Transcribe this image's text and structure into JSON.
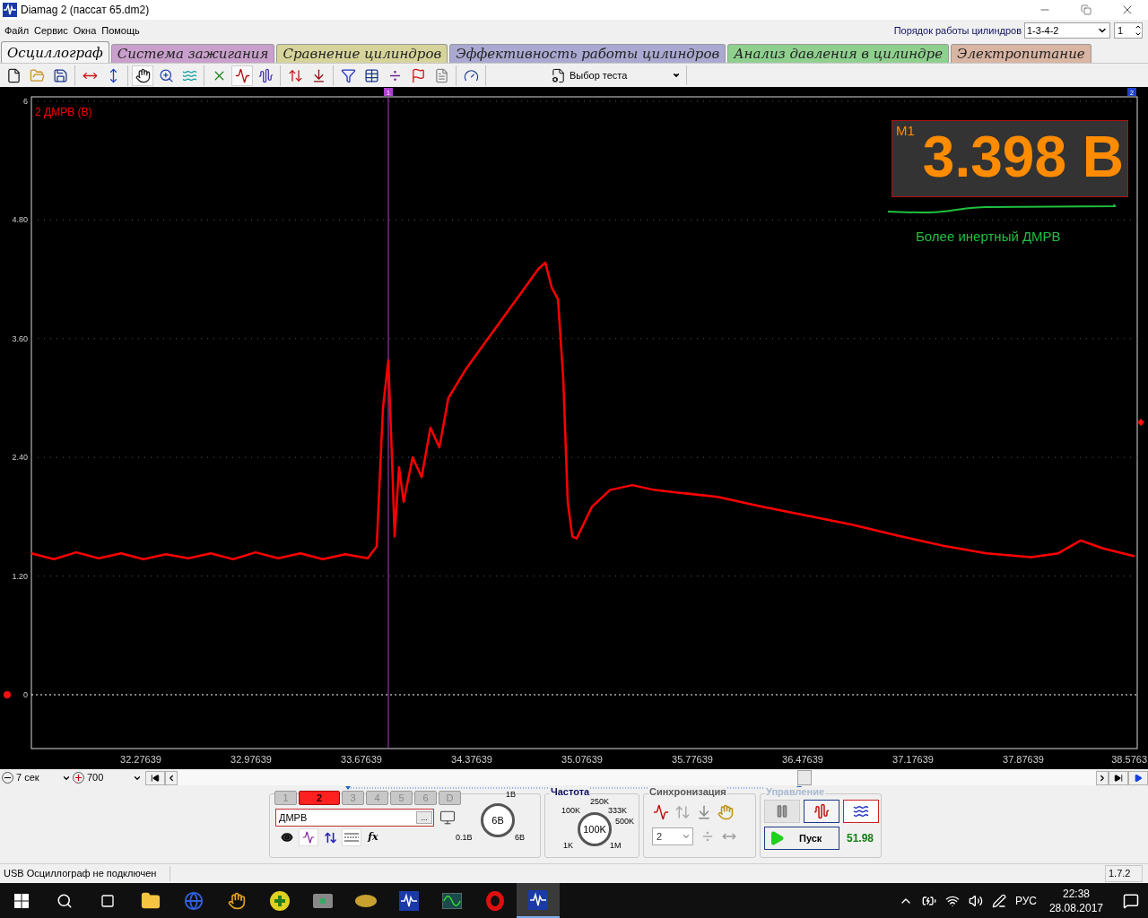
{
  "window": {
    "title": "Diamag 2 (пассат 65.dm2)"
  },
  "menu": [
    "Файл",
    "Сервис",
    "Окна",
    "Помощь"
  ],
  "cylinder_order": {
    "label": "Порядок работы цилиндров",
    "value": "1-3-4-2",
    "cylinder": "1"
  },
  "tabs": [
    {
      "label": "Осциллограф",
      "selected": true,
      "color": "#f4f4f4"
    },
    {
      "label": "Система зажигания",
      "selected": false,
      "color": "#c9a0cc"
    },
    {
      "label": "Сравнение цилиндров",
      "selected": false,
      "color": "#d6d49a"
    },
    {
      "label": "Эффективность работы цилиндров",
      "selected": false,
      "color": "#a9a9d2"
    },
    {
      "label": "Анализ давления в цилиндре",
      "selected": false,
      "color": "#8fd08f"
    },
    {
      "label": "Электропитание",
      "selected": false,
      "color": "#d9b5a3"
    }
  ],
  "toolbar": {
    "groups": [
      [
        {
          "kind": "new",
          "selected": false
        },
        {
          "kind": "open",
          "selected": false
        },
        {
          "kind": "save",
          "selected": false
        }
      ],
      [
        {
          "kind": "span-h",
          "selected": false
        },
        {
          "kind": "span-v",
          "selected": false
        }
      ],
      [
        {
          "kind": "hand",
          "selected": true
        },
        {
          "kind": "zoom",
          "selected": false
        },
        {
          "kind": "fit",
          "selected": false
        }
      ],
      [
        {
          "kind": "cross",
          "selected": false
        },
        {
          "kind": "stack",
          "selected": true
        },
        {
          "kind": "overlay",
          "selected": false
        }
      ],
      [
        {
          "kind": "auto",
          "selected": false
        },
        {
          "kind": "zero",
          "selected": false
        }
      ],
      [
        {
          "kind": "filter",
          "selected": false
        },
        {
          "kind": "grid",
          "selected": false
        },
        {
          "kind": "divide",
          "selected": false
        },
        {
          "kind": "flag",
          "selected": false
        },
        {
          "kind": "checklist",
          "selected": false
        }
      ],
      [
        {
          "kind": "gauge",
          "selected": false
        }
      ]
    ],
    "test_select": "Выбор теста"
  },
  "scope": {
    "chart_data": {
      "type": "line",
      "xlim": [
        31.582,
        38.599
      ],
      "ylim": [
        -0.544,
        6.045
      ],
      "x": [
        31.582,
        31.724,
        31.867,
        32.009,
        32.151,
        32.293,
        32.436,
        32.578,
        32.72,
        32.862,
        33.005,
        33.147,
        33.289,
        33.431,
        33.574,
        33.716,
        33.773,
        33.813,
        33.847,
        33.87,
        33.887,
        33.915,
        33.944,
        34.001,
        34.058,
        34.114,
        34.171,
        34.228,
        34.342,
        34.456,
        34.57,
        34.684,
        34.797,
        34.843,
        34.883,
        34.923,
        34.957,
        34.985,
        35.014,
        35.042,
        35.139,
        35.253,
        35.395,
        35.537,
        35.708,
        35.936,
        36.22,
        36.505,
        36.789,
        37.074,
        37.358,
        37.643,
        37.927,
        38.098,
        38.24,
        38.383,
        38.582
      ],
      "series": [
        {
          "name": "2 ДМРВ (В)",
          "color": "#ff0000",
          "values": [
            1.43,
            1.37,
            1.44,
            1.38,
            1.43,
            1.37,
            1.42,
            1.38,
            1.43,
            1.37,
            1.44,
            1.38,
            1.43,
            1.37,
            1.42,
            1.38,
            1.5,
            2.9,
            3.38,
            2.4,
            1.6,
            2.3,
            1.95,
            2.4,
            2.2,
            2.7,
            2.5,
            3.0,
            3.3,
            3.55,
            3.8,
            4.05,
            4.3,
            4.37,
            4.12,
            4.0,
            3.2,
            1.95,
            1.6,
            1.58,
            1.9,
            2.07,
            2.12,
            2.07,
            2.04,
            2.0,
            1.9,
            1.81,
            1.72,
            1.61,
            1.51,
            1.43,
            1.39,
            1.43,
            1.56,
            1.48,
            1.4
          ]
        }
      ],
      "xticks": [
        {
          "value": 32.27639,
          "label": "32.27639"
        },
        {
          "value": 32.97639,
          "label": "32.97639"
        },
        {
          "value": 33.67639,
          "label": "33.67639"
        },
        {
          "value": 34.37639,
          "label": "34.37639"
        },
        {
          "value": 35.07639,
          "label": "35.07639"
        },
        {
          "value": 35.77639,
          "label": "35.77639"
        },
        {
          "value": 36.47639,
          "label": "36.47639"
        },
        {
          "value": 37.17639,
          "label": "37.17639"
        },
        {
          "value": 37.87639,
          "label": "37.87639"
        },
        {
          "value": 38.5763,
          "label": "38.5763"
        }
      ],
      "grid": true,
      "ref_lines": [
        {
          "axis": "y",
          "value": 0,
          "color": "#ffffff"
        },
        {
          "axis": "x",
          "value": 33.847,
          "color": "#b040d0"
        }
      ],
      "yticks": [
        {
          "value": 0,
          "label": "0"
        },
        {
          "value": 1.2,
          "label": "1.20"
        },
        {
          "value": 2.4,
          "label": "2.40"
        },
        {
          "value": 3.6,
          "label": "3.60"
        },
        {
          "value": 4.8,
          "label": "4.80"
        },
        {
          "value": 6,
          "label": "6"
        }
      ]
    },
    "cursor_flags": [
      {
        "label": "1"
      },
      {
        "label": "2"
      }
    ],
    "measurement": {
      "label": "M1",
      "value": "3.398 В"
    },
    "note": "Более инертный ДМРВ"
  },
  "timebase": {
    "time": "7 сек",
    "points": "700"
  },
  "channel_panel": {
    "channels": [
      {
        "label": "1",
        "selected": false
      },
      {
        "label": "2",
        "selected": true
      },
      {
        "label": "3",
        "selected": false
      },
      {
        "label": "4",
        "selected": false
      },
      {
        "label": "5",
        "selected": false
      },
      {
        "label": "6",
        "selected": false
      },
      {
        "label": "D",
        "selected": false
      }
    ],
    "signal": "ДМРВ",
    "browse": "...",
    "function": "fx",
    "knob": {
      "value": "6В",
      "labels": [
        "1В",
        "0.1В",
        "6В"
      ]
    }
  },
  "frequency": {
    "title": "Частота",
    "knob": {
      "value": "100K",
      "labels": [
        "250K",
        "100K",
        "333K",
        "500K",
        "1K",
        "1M"
      ]
    }
  },
  "sync": {
    "title": "Синхронизация",
    "channel": "2"
  },
  "control": {
    "title": "Управление",
    "disabled": true,
    "modes": [
      {
        "kind": "pause",
        "selected": false
      },
      {
        "kind": "sine",
        "selected": true
      },
      {
        "kind": "multi",
        "selected": false
      }
    ],
    "start": "Пуск",
    "reading": "51.98"
  },
  "status_bar": {
    "message": "USB Осциллограф не подключен",
    "version": "1.7.2"
  },
  "taskbar": {
    "language": "РУС",
    "time": "22:38",
    "date": "28.08.2017"
  }
}
